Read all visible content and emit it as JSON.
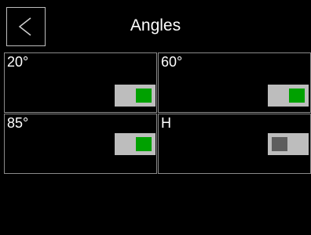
{
  "header": {
    "back_icon": "chevron-left-icon",
    "title": "Angles"
  },
  "angles": [
    {
      "label": "20°",
      "enabled": true
    },
    {
      "label": "60°",
      "enabled": true
    },
    {
      "label": "85°",
      "enabled": true
    },
    {
      "label": "H",
      "enabled": false
    }
  ],
  "colors": {
    "background": "#000000",
    "toggle_track": "#bdbdbd",
    "toggle_on": "#00a100",
    "toggle_off": "#5d5d5d",
    "grid_line": "#8a8a8a"
  }
}
